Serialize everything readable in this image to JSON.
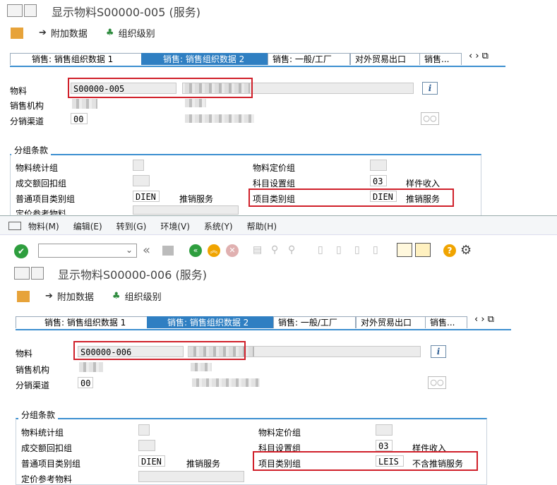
{
  "top": {
    "title": "显示物料S00000-005 (服务)",
    "toolbar": {
      "additional_data": "附加数据",
      "org_levels": "组织级别"
    },
    "tabs": [
      "销售: 销售组织数据 1",
      "销售: 销售组织数据 2",
      "销售: 一般/工厂",
      "对外贸易出口",
      "销售..."
    ],
    "fields": {
      "material_label": "物料",
      "material_value": "S00000-005",
      "sales_org_label": "销售机构",
      "dist_channel_label": "分销渠道",
      "dist_channel_value": "00"
    },
    "group": {
      "title": "分组条款",
      "mat_stat_group": "物料统计组",
      "rebate_group": "成交额回扣组",
      "gen_item_cat_group": "普通项目类别组",
      "gen_item_cat_value": "DIEN",
      "gen_item_cat_text": "推销服务",
      "pricing_ref_material": "定价参考物料",
      "mat_price_group": "物料定价组",
      "acct_assign_group": "科目设置组",
      "acct_assign_value": "03",
      "acct_assign_text": "样件收入",
      "item_cat_group": "项目类别组",
      "item_cat_value": "DIEN",
      "item_cat_text": "推销服务"
    }
  },
  "bottom": {
    "menu": [
      "物料(M)",
      "编辑(E)",
      "转到(G)",
      "环境(V)",
      "系统(Y)",
      "帮助(H)"
    ],
    "title": "显示物料S00000-006 (服务)",
    "toolbar": {
      "additional_data": "附加数据",
      "org_levels": "组织级别"
    },
    "tabs": [
      "销售: 销售组织数据 1",
      "销售: 销售组织数据 2",
      "销售: 一般/工厂",
      "对外贸易出口",
      "销售..."
    ],
    "fields": {
      "material_label": "物料",
      "material_value": "S00000-006",
      "sales_org_label": "销售机构",
      "dist_channel_label": "分销渠道",
      "dist_channel_value": "00"
    },
    "group": {
      "title": "分组条款",
      "mat_stat_group": "物料统计组",
      "rebate_group": "成交额回扣组",
      "gen_item_cat_group": "普通项目类别组",
      "gen_item_cat_value": "DIEN",
      "gen_item_cat_text": "推销服务",
      "pricing_ref_material": "定价参考物料",
      "mat_price_group": "物料定价组",
      "acct_assign_group": "科目设置组",
      "acct_assign_value": "03",
      "acct_assign_text": "样件收入",
      "item_cat_group": "项目类别组",
      "item_cat_value": "LEIS",
      "item_cat_text": "不含推销服务"
    }
  },
  "colors": {
    "accent": "#2f7fc2",
    "highlight": "#d0202a",
    "check": "#2e9e3e",
    "help": "#f0a400"
  }
}
